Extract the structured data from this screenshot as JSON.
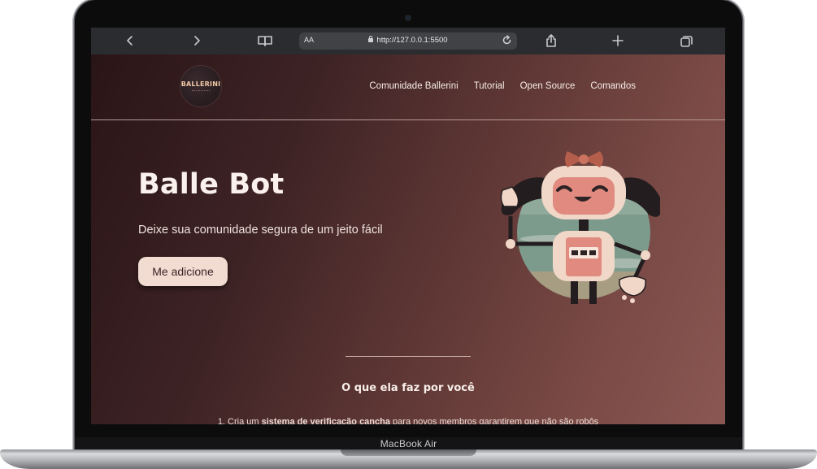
{
  "device": {
    "model_label": "MacBook Air"
  },
  "browser": {
    "text_size_label": "AA",
    "url": "http://127.0.0.1:5500",
    "icons": [
      "back-icon",
      "forward-icon",
      "book-icon",
      "lock-icon",
      "reload-icon",
      "share-icon",
      "plus-icon",
      "tabs-icon"
    ]
  },
  "site": {
    "logo_text": "BALLERINI",
    "nav": [
      "Comunidade Ballerini",
      "Tutorial",
      "Open Source",
      "Comandos"
    ],
    "hero": {
      "title": "Balle Bot",
      "subtitle": "Deixe sua comunidade segura de um jeito fácil",
      "cta_label": "Me adicione"
    },
    "section": {
      "title": "O que ela faz por você",
      "item1_prefix": "1. Cria um ",
      "item1_bold": "sistema de verificação cancha",
      "item1_suffix": " para novos membros garantirem que não são robôs"
    },
    "colors": {
      "background_dark": "#2a1516",
      "background_light": "#8b5752",
      "button_bg": "#f2dbd0",
      "text_light": "#faf1ec"
    }
  }
}
